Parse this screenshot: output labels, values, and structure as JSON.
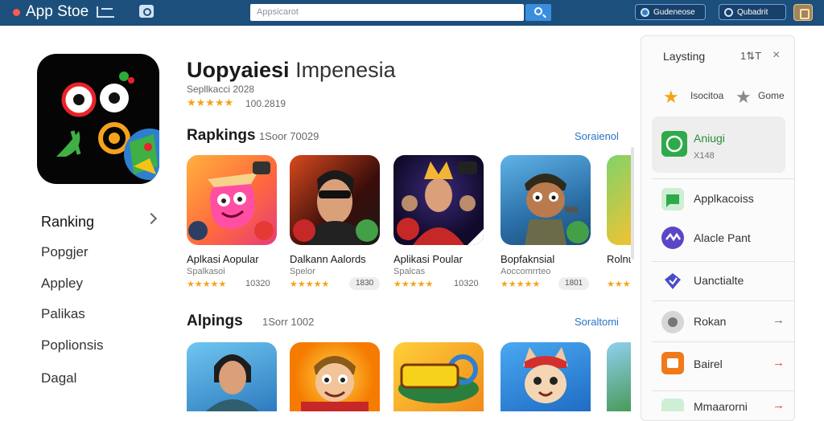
{
  "window": {
    "title": "App Stoe"
  },
  "search": {
    "placeholder": "Appsicarot"
  },
  "header_buttons": {
    "primary": "Gudeneose",
    "secondary": "Qubadrit"
  },
  "app": {
    "title_bold": "Uopyaiesi",
    "title_rest": " Impenesia",
    "subtitle": "Sepllkacci 2028",
    "stars": "★★★★★",
    "rating": "100.2819"
  },
  "nav": {
    "items": [
      "Ranking",
      "Popgjer",
      "Appley",
      "Palikas",
      "Poplionsis",
      "Dagal"
    ]
  },
  "sections": [
    {
      "title": "Rapkings",
      "subtitle": "· 1Soor 70029",
      "link": "Soraienol",
      "cards": [
        {
          "title": "Aplkasi Aopular",
          "sub": "Spalkasoi",
          "stars": "★★★★★",
          "count": "10320",
          "badge": ""
        },
        {
          "title": "Dalkann Aalords",
          "sub": "Spelor",
          "stars": "★★★★★",
          "count": "",
          "badge": "1830"
        },
        {
          "title": "Aplikasi Poular",
          "sub": "Spalcas",
          "stars": "★★★★★",
          "count": "10320",
          "badge": ""
        },
        {
          "title": "Bopfaknsial",
          "sub": "Aoccomrrteo",
          "stars": "★★★★★",
          "count": "",
          "badge": "1801"
        },
        {
          "title": "Rolnu",
          "sub": "",
          "stars": "★★★",
          "count": "",
          "badge": ""
        }
      ]
    },
    {
      "title": "Alpings",
      "subtitle": "1Sorr 1002",
      "link": "Soraltomi"
    }
  ],
  "panel": {
    "title": "Laysting",
    "icon_text": "1⇅T",
    "close": "×",
    "tags": [
      "Isocitoa",
      "Gome"
    ],
    "highlight": {
      "name": "Aniugi",
      "meta": "X148"
    },
    "rows": [
      "Applkacoiss",
      "Alacle Pant",
      "Uanctialte",
      "Rokan",
      "Bairel",
      "Mmaarorni"
    ]
  },
  "colors": {
    "header": "#1d4f7c",
    "accent": "#2b72c6",
    "star": "#f4a418"
  }
}
